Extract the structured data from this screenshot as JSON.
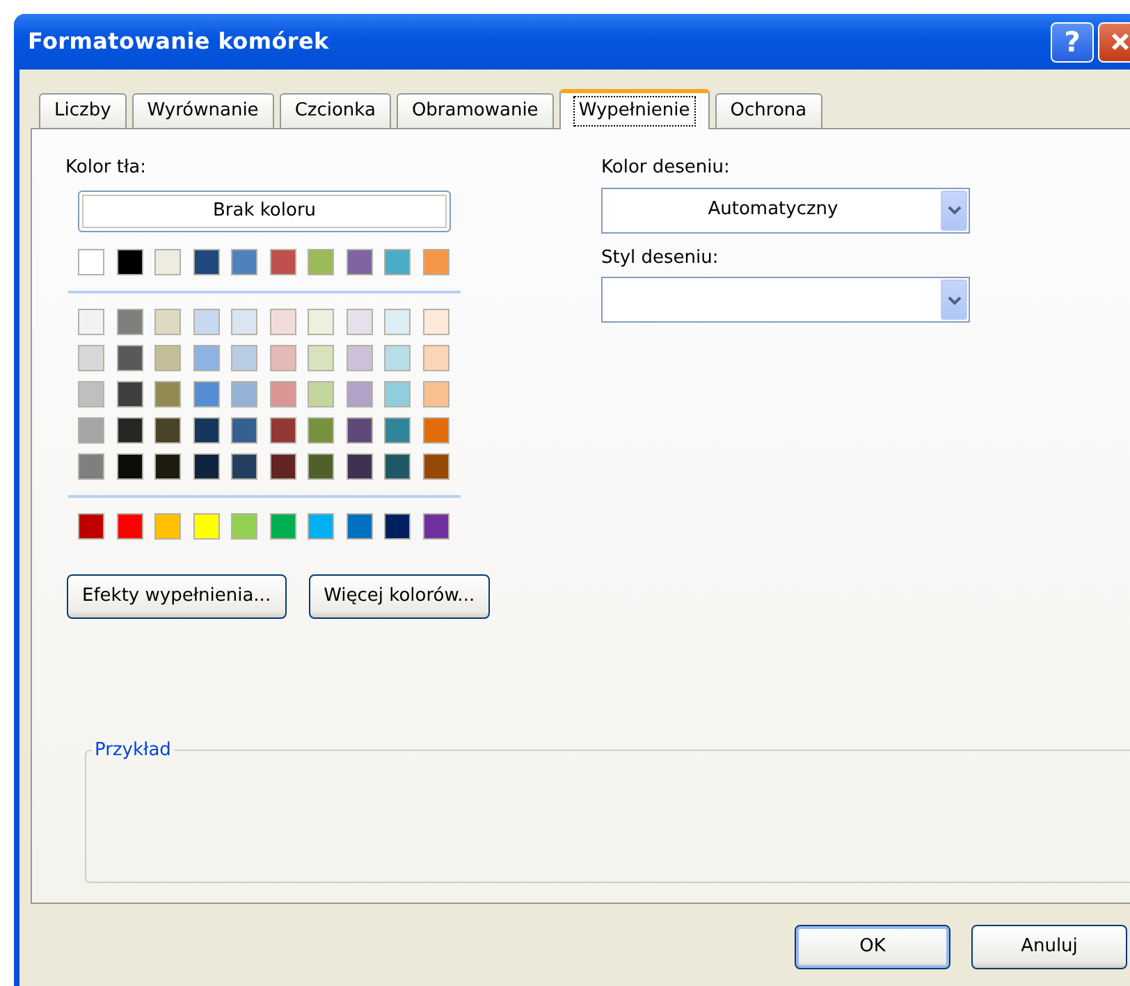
{
  "window": {
    "title": "Formatowanie komórek",
    "help_button": "?"
  },
  "tabs": [
    {
      "label": "Liczby",
      "selected": false
    },
    {
      "label": "Wyrównanie",
      "selected": false
    },
    {
      "label": "Czcionka",
      "selected": false
    },
    {
      "label": "Obramowanie",
      "selected": false
    },
    {
      "label": "Wypełnienie",
      "selected": true
    },
    {
      "label": "Ochrona",
      "selected": false
    }
  ],
  "background": {
    "label": "Kolor tła:",
    "no_color_button": "Brak koloru",
    "groups": [
      {
        "rows": [
          {
            "swatches": [
              {
                "color": "#ffffff"
              },
              {
                "color": "#000000"
              },
              {
                "color": "#eeece1"
              },
              {
                "color": "#1f497d"
              },
              {
                "color": "#4f81bd"
              },
              {
                "color": "#c0504d"
              },
              {
                "color": "#9bbb59"
              },
              {
                "color": "#8064a2"
              },
              {
                "color": "#4bacc6"
              },
              {
                "color": "#f79646"
              }
            ]
          }
        ]
      },
      {
        "rows": [
          {
            "swatches": [
              {
                "color": "#f2f2f2"
              },
              {
                "color": "#7f7f7f"
              },
              {
                "color": "#ddd9c3"
              },
              {
                "color": "#c6d9f0"
              },
              {
                "color": "#dbe5f1"
              },
              {
                "color": "#f2dcdb"
              },
              {
                "color": "#ebf1dd"
              },
              {
                "color": "#e5e0ec"
              },
              {
                "color": "#dbeef3"
              },
              {
                "color": "#fdeada"
              }
            ]
          },
          {
            "swatches": [
              {
                "color": "#d8d8d8"
              },
              {
                "color": "#595959"
              },
              {
                "color": "#c4bd97"
              },
              {
                "color": "#8db3e2"
              },
              {
                "color": "#b8cce4"
              },
              {
                "color": "#e5b9b7"
              },
              {
                "color": "#d7e3bc"
              },
              {
                "color": "#ccc1d9"
              },
              {
                "color": "#b7dde8"
              },
              {
                "color": "#fbd5b5"
              }
            ]
          },
          {
            "swatches": [
              {
                "color": "#bfbfbf"
              },
              {
                "color": "#3f3f3f"
              },
              {
                "color": "#938953"
              },
              {
                "color": "#548dd4"
              },
              {
                "color": "#95b3d7"
              },
              {
                "color": "#d99694"
              },
              {
                "color": "#c3d69b"
              },
              {
                "color": "#b2a2c7"
              },
              {
                "color": "#92cddc"
              },
              {
                "color": "#fac08f"
              }
            ]
          },
          {
            "swatches": [
              {
                "color": "#a5a5a5"
              },
              {
                "color": "#262626"
              },
              {
                "color": "#494429"
              },
              {
                "color": "#17365d"
              },
              {
                "color": "#366092"
              },
              {
                "color": "#953734"
              },
              {
                "color": "#76923c"
              },
              {
                "color": "#5f497a"
              },
              {
                "color": "#31859b"
              },
              {
                "color": "#e36c09"
              }
            ]
          },
          {
            "swatches": [
              {
                "color": "#7f7f7f"
              },
              {
                "color": "#0c0c0c"
              },
              {
                "color": "#1d1b10"
              },
              {
                "color": "#0f243e"
              },
              {
                "color": "#244061"
              },
              {
                "color": "#632423"
              },
              {
                "color": "#4f6128"
              },
              {
                "color": "#3f3151"
              },
              {
                "color": "#205867"
              },
              {
                "color": "#974806"
              }
            ]
          }
        ]
      },
      {
        "rows": [
          {
            "swatches": [
              {
                "color": "#c00000"
              },
              {
                "color": "#ff0000"
              },
              {
                "color": "#ffc000"
              },
              {
                "color": "#ffff00"
              },
              {
                "color": "#92d050"
              },
              {
                "color": "#00b050"
              },
              {
                "color": "#00b0f0"
              },
              {
                "color": "#0070c0"
              },
              {
                "color": "#002060"
              },
              {
                "color": "#7030a0"
              }
            ]
          }
        ]
      }
    ],
    "buttons": [
      "Efekty wypełnienia...",
      "Więcej kolorów..."
    ]
  },
  "pattern": {
    "color_label": "Kolor deseniu:",
    "color_value": "Automatyczny",
    "style_label": "Styl deseniu:"
  },
  "sample": {
    "legend": "Przykład"
  },
  "buttons": [
    {
      "label": "OK",
      "default": true
    },
    {
      "label": "Anuluj",
      "default": false
    }
  ]
}
